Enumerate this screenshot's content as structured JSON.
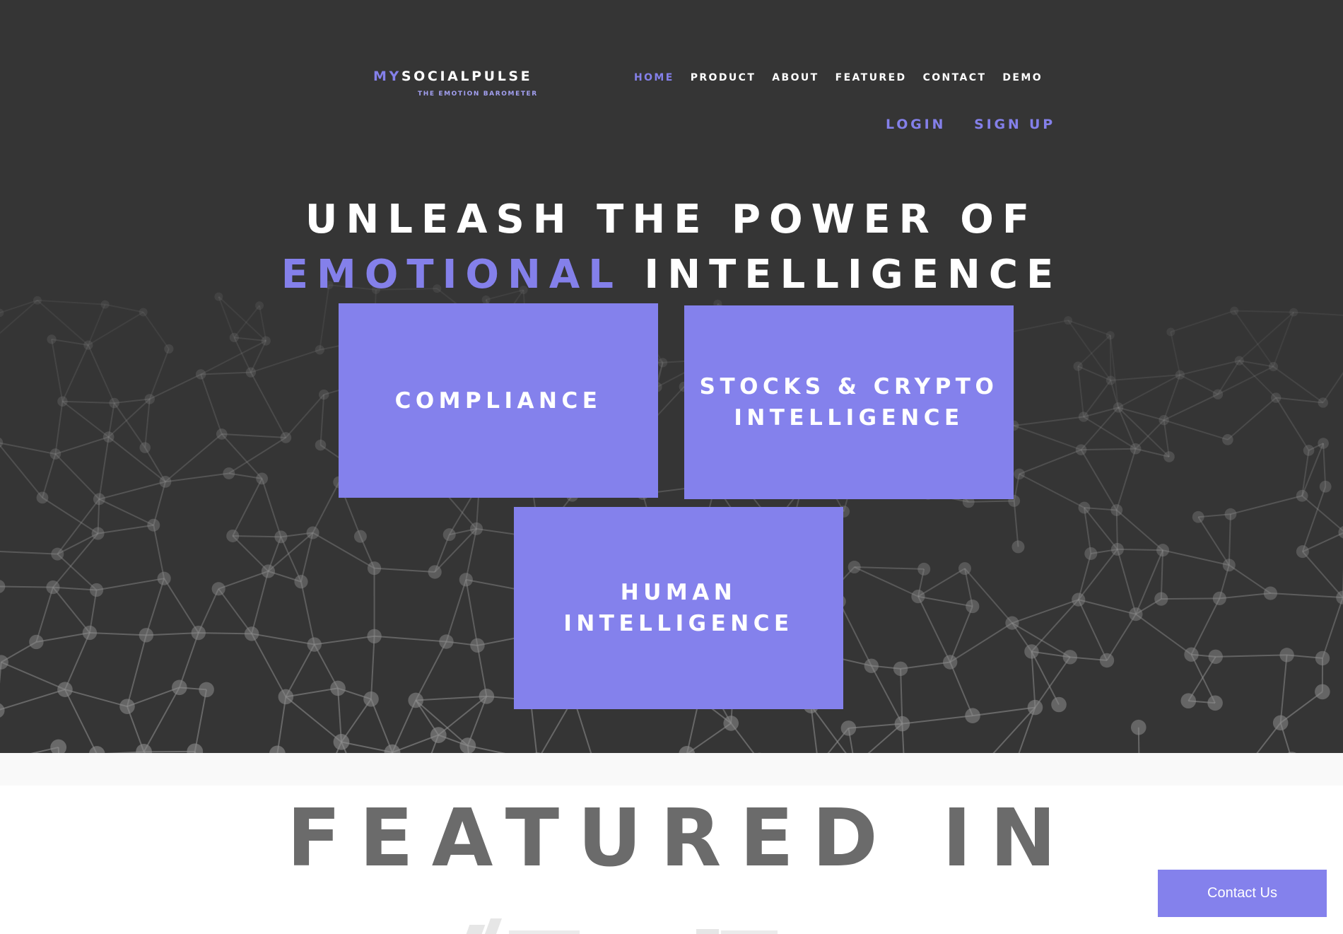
{
  "brand": {
    "name_accent": "MY",
    "name_rest": "SOCIALPULSE",
    "tagline": "THE EMOTION BAROMETER"
  },
  "nav": {
    "items": [
      {
        "label": "HOME",
        "active": true
      },
      {
        "label": "PRODUCT",
        "active": false
      },
      {
        "label": "ABOUT",
        "active": false
      },
      {
        "label": "FEATURED",
        "active": false
      },
      {
        "label": "CONTACT",
        "active": false
      },
      {
        "label": "DEMO",
        "active": false
      }
    ]
  },
  "auth": {
    "login_label": "LOGIN",
    "signup_label": "SIGN UP"
  },
  "hero": {
    "line1": "UNLEASH THE POWER OF",
    "line2_accent": "EMOTIONAL",
    "line2_rest": "INTELLIGENCE",
    "cards": [
      {
        "lines": [
          "COMPLIANCE"
        ]
      },
      {
        "lines": [
          "STOCKS & CRYPTO",
          "INTELLIGENCE"
        ]
      },
      {
        "lines": [
          "HUMAN",
          "INTELLIGENCE"
        ]
      }
    ]
  },
  "featured": {
    "title": "FEATURED IN"
  },
  "contact_button": {
    "label": "Contact Us"
  },
  "colors": {
    "accent": "#8480ea",
    "card": "#8481ec",
    "hero_bg": "#353535",
    "featured_title": "#6b6b6b"
  }
}
